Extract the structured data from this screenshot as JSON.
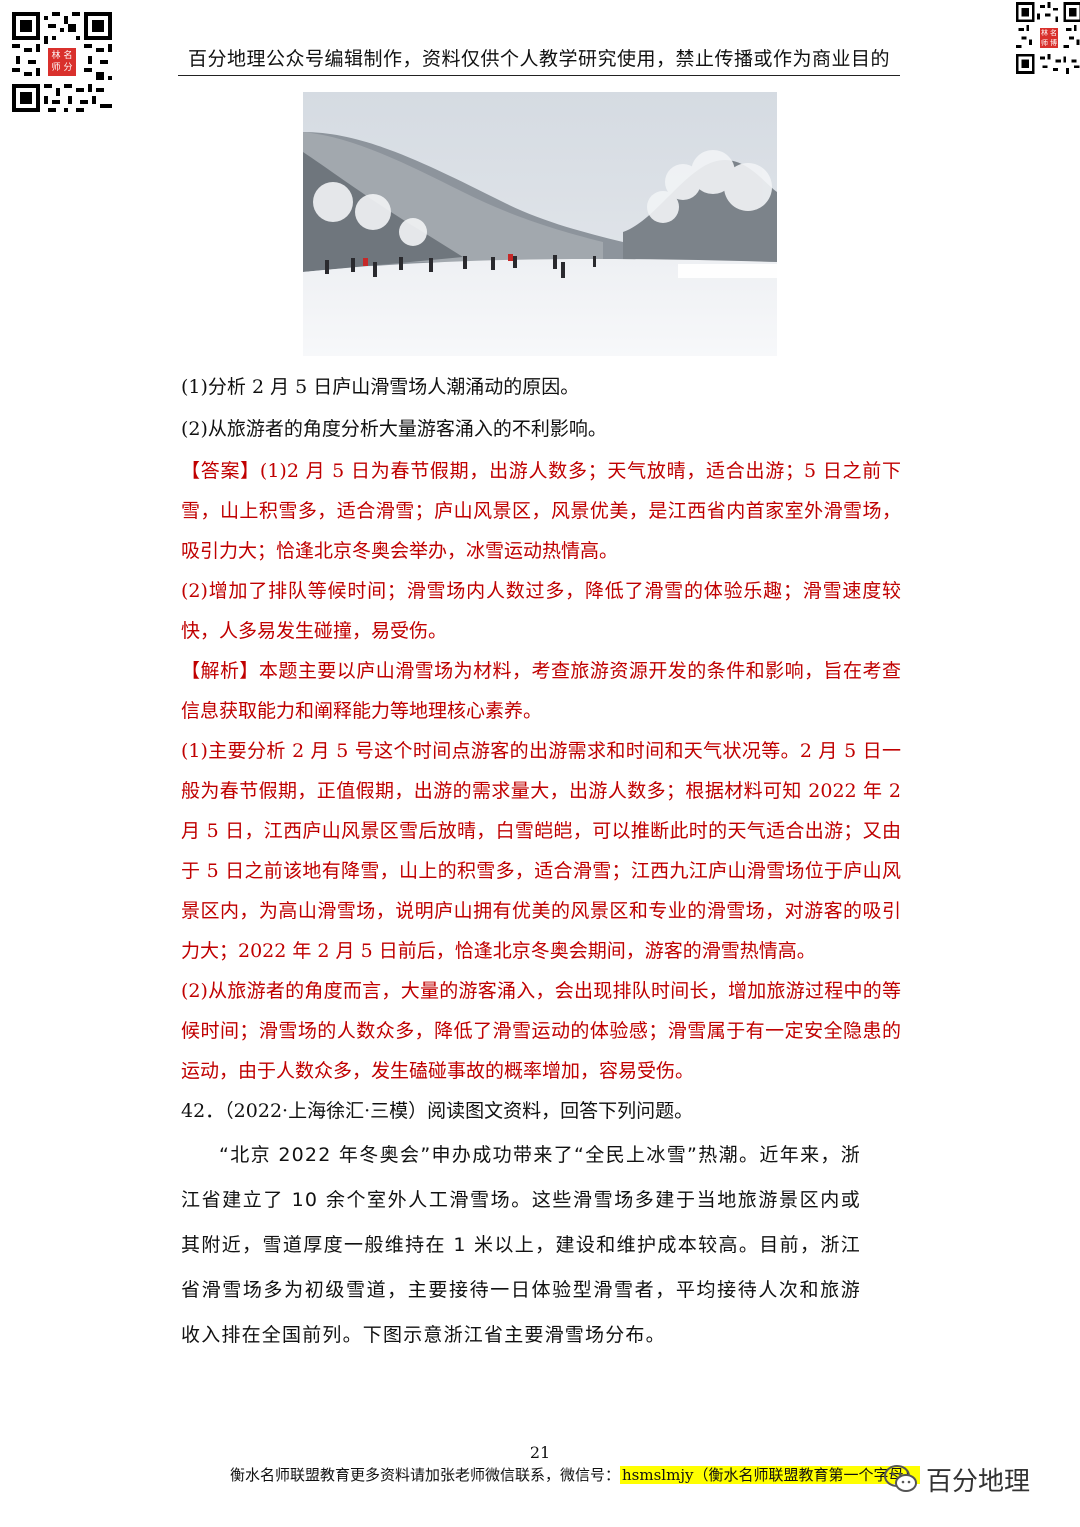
{
  "header": {
    "text": "百分地理公众号编辑制作，资料仅供个人教学研究使用，禁止传播或作为商业目的"
  },
  "qr_left": {
    "seal": [
      "林",
      "名",
      "师",
      "分"
    ]
  },
  "qr_right": {
    "seal": [
      "林",
      "名",
      "师",
      "博"
    ]
  },
  "questions": {
    "q1": "(1)分析 2 月 5 日庐山滑雪场人潮涌动的原因。",
    "q2": "(2)从旅游者的角度分析大量游客涌入的不利影响。"
  },
  "answer": {
    "label": "【答案】",
    "part1": "(1)2 月 5 日为春节假期，出游人数多；天气放晴，适合出游；5 日之前下雪，山上积雪多，适合滑雪；庐山风景区，风景优美，是江西省内首家室外滑雪场，吸引力大；恰逢北京冬奥会举办，冰雪运动热情高。",
    "part2": "(2)增加了排队等候时间；滑雪场内人数过多，降低了滑雪的体验乐趣；滑雪速度较快，人多易发生碰撞，易受伤。"
  },
  "analysis": {
    "label": "【解析】",
    "intro": "本题主要以庐山滑雪场为材料，考查旅游资源开发的条件和影响，旨在考查信息获取能力和阐释能力等地理核心素养。",
    "part1": "(1)主要分析 2 月 5 号这个时间点游客的出游需求和时间和天气状况等。2 月 5 日一般为春节假期，正值假期，出游的需求量大，出游人数多；根据材料可知 2022 年 2 月 5 日，江西庐山风景区雪后放晴，白雪皑皑，可以推断此时的天气适合出游；又由于 5 日之前该地有降雪，山上的积雪多，适合滑雪；江西九江庐山滑雪场位于庐山风景区内，为高山滑雪场，说明庐山拥有优美的风景区和专业的滑雪场，对游客的吸引力大；2022 年 2 月 5 日前后，恰逢北京冬奥会期间，游客的滑雪热情高。",
    "part2": "(2)从旅游者的角度而言，大量的游客涌入，会出现排队时间长，增加旅游过程中的等候时间；滑雪场的人数众多，降低了滑雪运动的体验感；滑雪属于有一定安全隐患的运动，由于人数众多，发生磕碰事故的概率增加，容易受伤。"
  },
  "q42": {
    "heading": "42．（2022·上海徐汇·三模）阅读图文资料，回答下列问题。",
    "body": "“北京 2022 年冬奥会”申办成功带来了“全民上冰雪”热潮。近年来，浙江省建立了 10 余个室外人工滑雪场。这些滑雪场多建于当地旅游景区内或其附近，雪道厚度一般维持在 1 米以上，建设和维护成本较高。目前，浙江省滑雪场多为初级雪道，主要接待一日体验型滑雪者，平均接待人次和旅游收入排在全国前列。下图示意浙江省主要滑雪场分布。"
  },
  "footer": {
    "page_number": "21",
    "text": "衡水名师联盟教育更多资料请加张老师微信联系，微信号：",
    "wechat": "hsmslmjy（衡水名师联盟教育第一个字母）",
    "brand": "百分地理"
  }
}
